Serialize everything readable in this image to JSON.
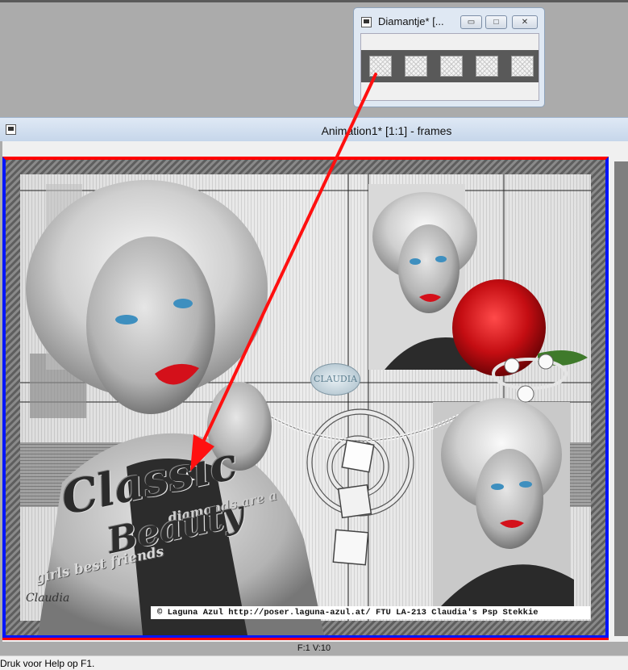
{
  "diamond_window": {
    "title": "Diamantje* [...",
    "buttons": {
      "minimize": "▭",
      "maximize": "□",
      "close": "✕"
    },
    "frame_count": 5
  },
  "animation_window": {
    "title": "Animation1* [1:1] - frames"
  },
  "artwork": {
    "title_classic": "Classic",
    "title_beauty": "Beauty",
    "tagline_1": "diamonds are a",
    "tagline_2": "girls best friends",
    "signature": "Claudia",
    "badge": "CLAUDIA",
    "copyright": "© Laguna Azul http://poser.laguna-azul.at/ FTU LA-213 Claudia's Psp Stekkie"
  },
  "frame_info": "F:1   V:10",
  "status_text": "Druk voor Help op F1.",
  "colors": {
    "selection_border": "#0015ff",
    "frame_border": "#ff0000",
    "arrow": "#ff1010"
  },
  "icons": {
    "app": "app-icon",
    "minimize": "minimize-icon",
    "maximize": "maximize-icon",
    "close": "close-icon"
  }
}
